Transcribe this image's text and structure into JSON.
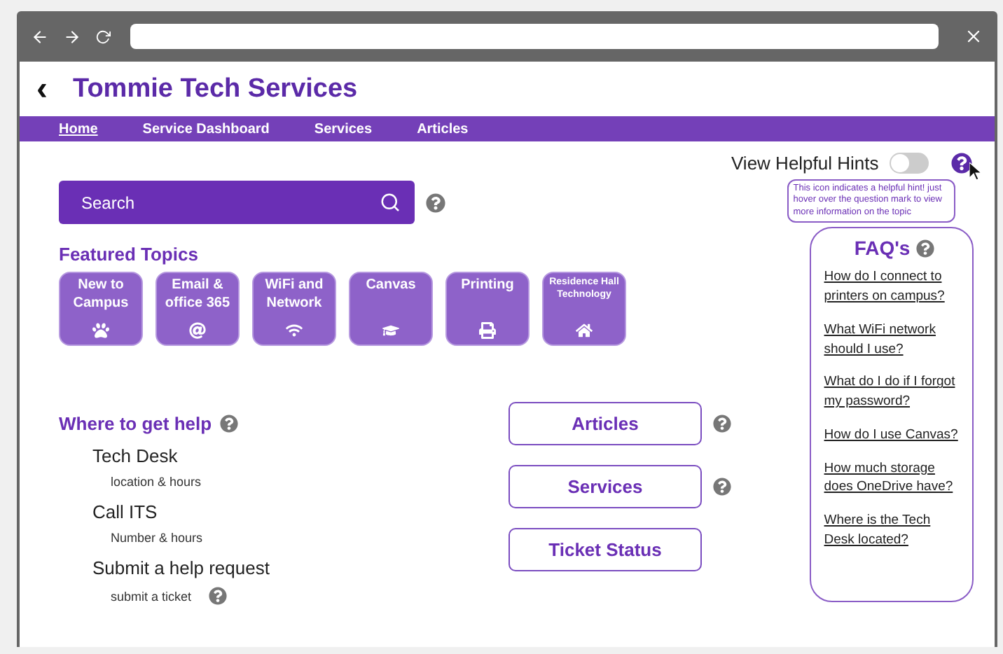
{
  "header": {
    "back": "‹",
    "title": "Tommie Tech Services"
  },
  "nav": [
    {
      "label": "Home",
      "selected": true
    },
    {
      "label": "Service Dashboard",
      "selected": false
    },
    {
      "label": "Services",
      "selected": false
    },
    {
      "label": "Articles",
      "selected": false
    }
  ],
  "search": {
    "placeholder": "Search"
  },
  "hints": {
    "label": "View Helpful Hints",
    "on": false,
    "tooltip": "This icon indicates a helpful hint! just hover over the question mark to view more information on the topic"
  },
  "featured": {
    "title": "Featured Topics",
    "topics": [
      {
        "label": "New to Campus",
        "small": false
      },
      {
        "label": "Email & office 365",
        "small": false
      },
      {
        "label": "WiFi and Network",
        "small": false
      },
      {
        "label": "Canvas",
        "small": false
      },
      {
        "label": "Printing",
        "small": false
      },
      {
        "label": "Residence Hall Technology",
        "small": true
      }
    ]
  },
  "help": {
    "title": "Where to get help",
    "items": [
      {
        "title": "Tech Desk",
        "detail": "location & hours",
        "hint": false
      },
      {
        "title": "Call ITS",
        "detail": "Number & hours",
        "hint": false
      },
      {
        "title": "Submit a help request",
        "detail": "submit a ticket",
        "hint": true
      }
    ]
  },
  "buttons": [
    {
      "label": "Articles",
      "hint": true
    },
    {
      "label": "Services",
      "hint": true
    },
    {
      "label": "Ticket Status",
      "hint": false
    }
  ],
  "faq": {
    "title": "FAQ's",
    "questions": [
      "How do I connect to printers on campus?",
      "What WiFi network should I use?",
      "What do I do if I forgot my password?",
      "How do I use Canvas?",
      "How much storage does OneDrive have?",
      "Where is the Tech Desk located?"
    ]
  }
}
